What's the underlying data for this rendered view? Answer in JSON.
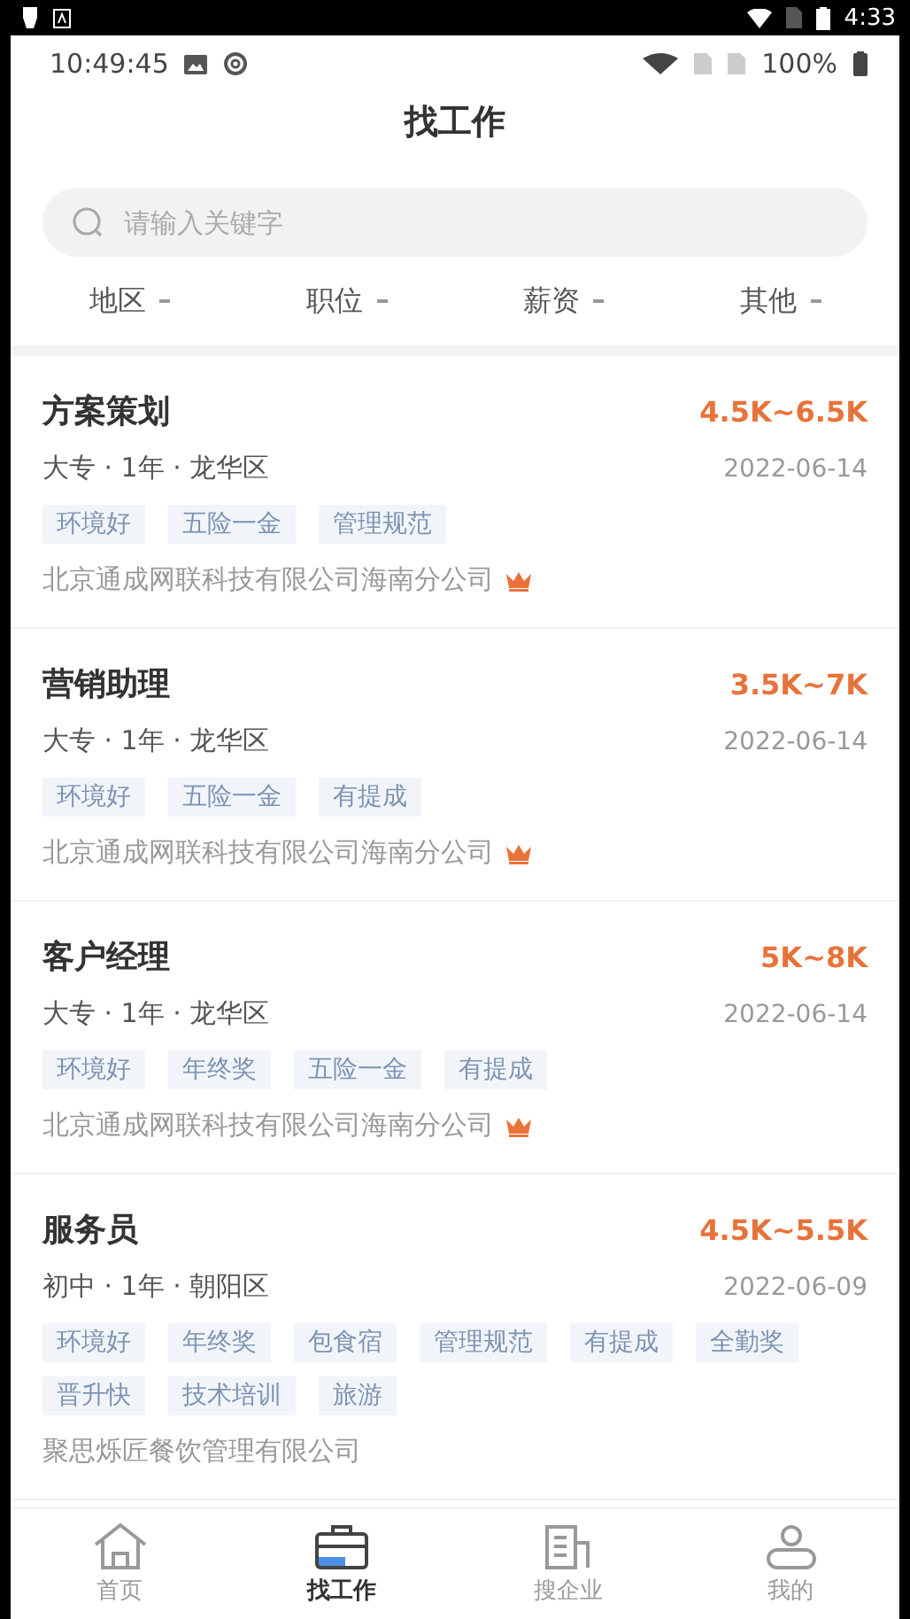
{
  "system_bar": {
    "time": "4:33"
  },
  "status_bar": {
    "time": "10:49:45",
    "battery": "100%"
  },
  "title": "找工作",
  "search": {
    "placeholder": "请输入关键字"
  },
  "filters": [
    {
      "label": "地区"
    },
    {
      "label": "职位"
    },
    {
      "label": "薪资"
    },
    {
      "label": "其他"
    }
  ],
  "jobs": [
    {
      "title": "方案策划",
      "salary": "4.5K~6.5K",
      "meta": "大专 · 1年 · 龙华区",
      "date": "2022-06-14",
      "tags": [
        "环境好",
        "五险一金",
        "管理规范"
      ],
      "company": "北京通成网联科技有限公司海南分公司",
      "crown": true
    },
    {
      "title": "营销助理",
      "salary": "3.5K~7K",
      "meta": "大专 · 1年 · 龙华区",
      "date": "2022-06-14",
      "tags": [
        "环境好",
        "五险一金",
        "有提成"
      ],
      "company": "北京通成网联科技有限公司海南分公司",
      "crown": true
    },
    {
      "title": "客户经理",
      "salary": "5K~8K",
      "meta": "大专 · 1年 · 龙华区",
      "date": "2022-06-14",
      "tags": [
        "环境好",
        "年终奖",
        "五险一金",
        "有提成"
      ],
      "company": "北京通成网联科技有限公司海南分公司",
      "crown": true
    },
    {
      "title": "服务员",
      "salary": "4.5K~5.5K",
      "meta": "初中 · 1年 · 朝阳区",
      "date": "2022-06-09",
      "tags": [
        "环境好",
        "年终奖",
        "包食宿",
        "管理规范",
        "有提成",
        "全勤奖",
        "晋升快",
        "技术培训",
        "旅游"
      ],
      "company": "聚思烁匠餐饮管理有限公司",
      "crown": false
    }
  ],
  "tab_bar": [
    {
      "label": "首页",
      "kind": "home",
      "selected": false
    },
    {
      "label": "找工作",
      "kind": "jobs",
      "selected": true
    },
    {
      "label": "搜企业",
      "kind": "company",
      "selected": false
    },
    {
      "label": "我的",
      "kind": "me",
      "selected": false
    }
  ]
}
